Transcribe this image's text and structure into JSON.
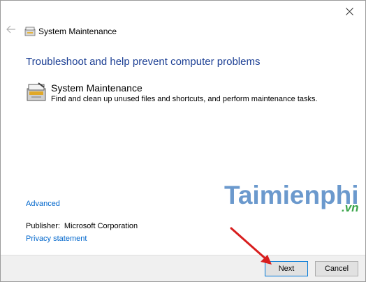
{
  "window": {
    "title": "System Maintenance",
    "accent_color": "#1c3f94",
    "link_color": "#0066cc"
  },
  "titlebar": {
    "close_icon": "close-icon"
  },
  "nav": {
    "back_icon": "back-arrow-icon",
    "app_icon": "maintenance-icon",
    "title": "System Maintenance"
  },
  "main": {
    "heading": "Troubleshoot and help prevent computer problems",
    "task": {
      "icon": "maintenance-icon",
      "title": "System Maintenance",
      "description": "Find and clean up unused files and shortcuts, and perform maintenance tasks."
    },
    "advanced_link": "Advanced",
    "publisher_label": "Publisher:",
    "publisher_value": "Microsoft Corporation",
    "privacy_link": "Privacy statement"
  },
  "footer": {
    "next_label": "Next",
    "cancel_label": "Cancel"
  },
  "watermark": {
    "brand": "Taimienphi",
    "tld": ".vn"
  }
}
